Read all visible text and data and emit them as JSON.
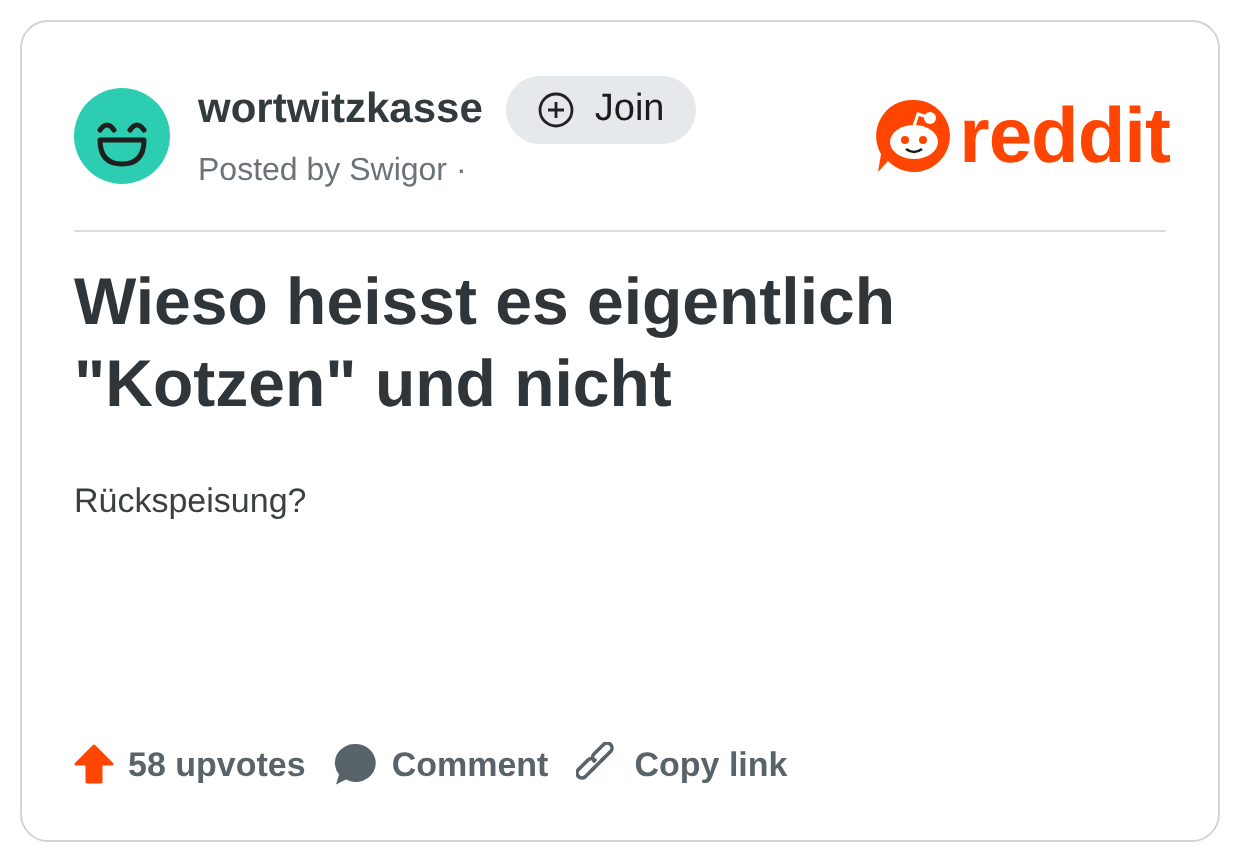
{
  "post": {
    "subreddit": "wortwitzkasse",
    "posted_by": "Posted by Swigor ·",
    "join_label": "Join",
    "logo": "reddit",
    "title": "Wieso heisst es eigentlich \"Kotzen\" und nicht",
    "body": "Rückspeisung?"
  },
  "actions": [
    {
      "kind": "upvote",
      "label": "58 upvotes"
    },
    {
      "kind": "comment",
      "label": "Comment"
    },
    {
      "kind": "link",
      "label": "Copy link"
    }
  ]
}
